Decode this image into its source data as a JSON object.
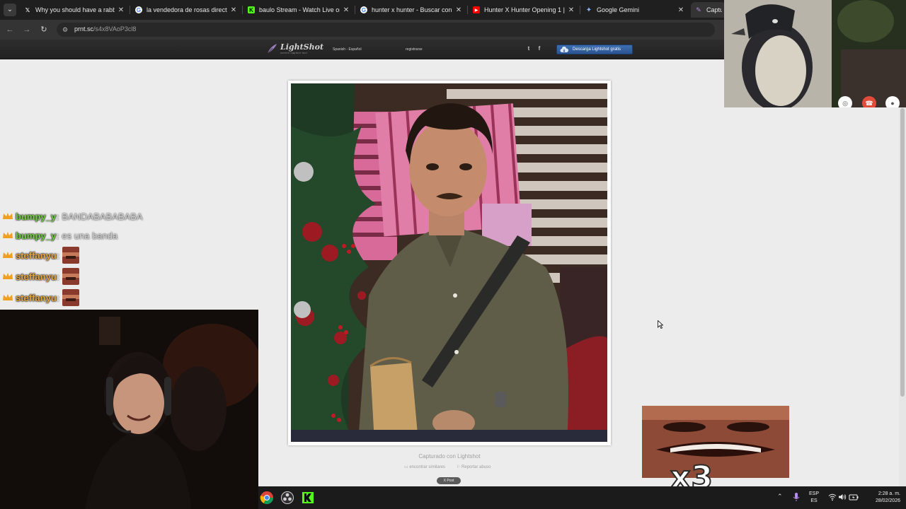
{
  "browser": {
    "tabs": [
      {
        "title": "Why you should have a rabbit a",
        "icon": "x-twitter-icon"
      },
      {
        "title": "la vendedora de rosas director",
        "icon": "google-icon"
      },
      {
        "title": "baulo Stream - Watch Live on K",
        "icon": "kick-icon"
      },
      {
        "title": "hunter x hunter - Buscar con G",
        "icon": "google-icon"
      },
      {
        "title": "Hunter X Hunter Opening 1 | D",
        "icon": "youtube-icon"
      },
      {
        "title": "Google Gemini",
        "icon": "gemini-icon"
      },
      {
        "title": "Captura",
        "icon": "lightshot-icon",
        "active": true
      }
    ],
    "close_glyph": "✕",
    "url": {
      "host": "prnt.sc",
      "path": "/s4x8VAoP3cl8"
    }
  },
  "lightshot": {
    "logo_text": "LightShot",
    "logo_tagline": "screen capture tool",
    "language": "Spanish - Español",
    "register": "registrarse",
    "download_button": "Descarga Lightshot gratis",
    "captured_by": "Capturado con Lightshot",
    "find_similar": "encontrar similares",
    "report_abuse": "Reportar abuso",
    "post_button": "X Post"
  },
  "chat": {
    "messages": [
      {
        "user": "bumpy_y",
        "text": "BANDABABABABA",
        "user_color": "#6fd13b"
      },
      {
        "user": "bumpy_y",
        "text": "es una banda",
        "user_color": "#6fd13b"
      },
      {
        "user": "steffanyu",
        "text": "",
        "user_color": "#e8a33a",
        "emote": true
      },
      {
        "user": "steffanyu",
        "text": "",
        "user_color": "#e8a33a",
        "emote": true
      },
      {
        "user": "steffanyu",
        "text": "",
        "user_color": "#e8a33a",
        "emote": true
      }
    ]
  },
  "meme": {
    "caption": "x3"
  },
  "taskbar": {
    "apps": [
      "chrome-icon",
      "obs-icon",
      "kick-icon"
    ],
    "language": "ESP",
    "language_sub": "ES",
    "time": "2:28 a. m.",
    "date": "28/02/2026"
  },
  "colors": {
    "chrome_dark": "#1f1f1f",
    "toolbar": "#343434",
    "lightshot_blue": "#2a5594",
    "page_bg": "#ececec",
    "taskbar": "#1b1b1b"
  }
}
